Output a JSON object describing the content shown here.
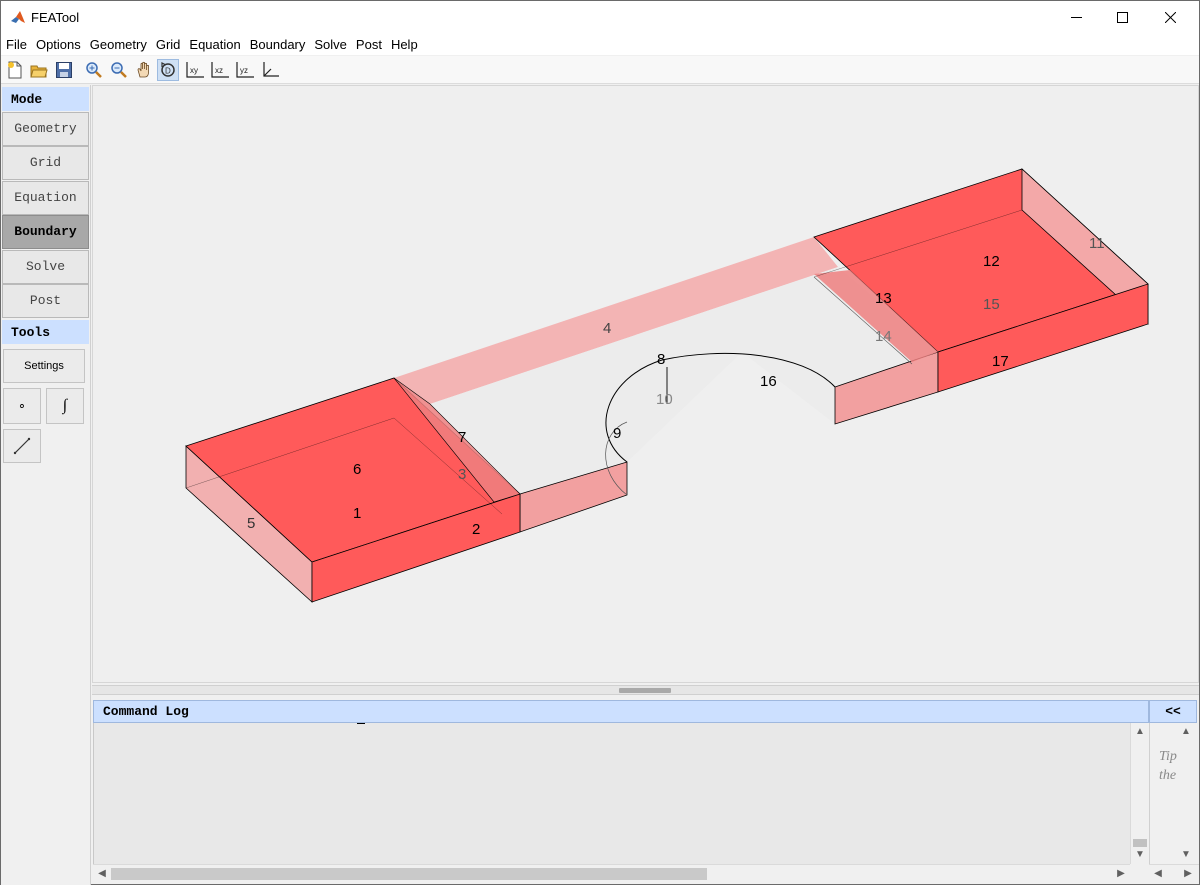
{
  "window": {
    "title": "FEATool"
  },
  "menu": [
    "File",
    "Options",
    "Geometry",
    "Grid",
    "Equation",
    "Boundary",
    "Solve",
    "Post",
    "Help"
  ],
  "toolbar": {
    "buttons": [
      "new-file",
      "open-folder",
      "save",
      "zoom-in",
      "zoom-out",
      "pan",
      "rotate-3d",
      "view-xy",
      "view-xz",
      "view-yz",
      "axes"
    ],
    "labels": {
      "xy": "xy",
      "xz": "xz",
      "yz": "yz"
    }
  },
  "left_panel": {
    "mode_header": "Mode",
    "modes": [
      "Geometry",
      "Grid",
      "Equation",
      "Boundary",
      "Solve",
      "Post"
    ],
    "selected_mode": "Boundary",
    "tools_header": "Tools",
    "settings_label": "Settings",
    "point_tool_glyph": "∘",
    "function_tool_glyph": "∫"
  },
  "canvas": {
    "boundary_labels": [
      "1",
      "2",
      "3",
      "4",
      "5",
      "6",
      "7",
      "8",
      "9",
      "10",
      "11",
      "12",
      "13",
      "14",
      "15",
      "16",
      "17"
    ],
    "colors": {
      "selected_fill": "#ff5a5a",
      "unselected_fill": "#f2b0b0",
      "edge": "#000000",
      "inner_fill": "#ececec"
    }
  },
  "command_log": {
    "title": "Command Log",
    "collapse_label": "<<",
    "tips_text": [
      "Tip",
      "the"
    ]
  }
}
